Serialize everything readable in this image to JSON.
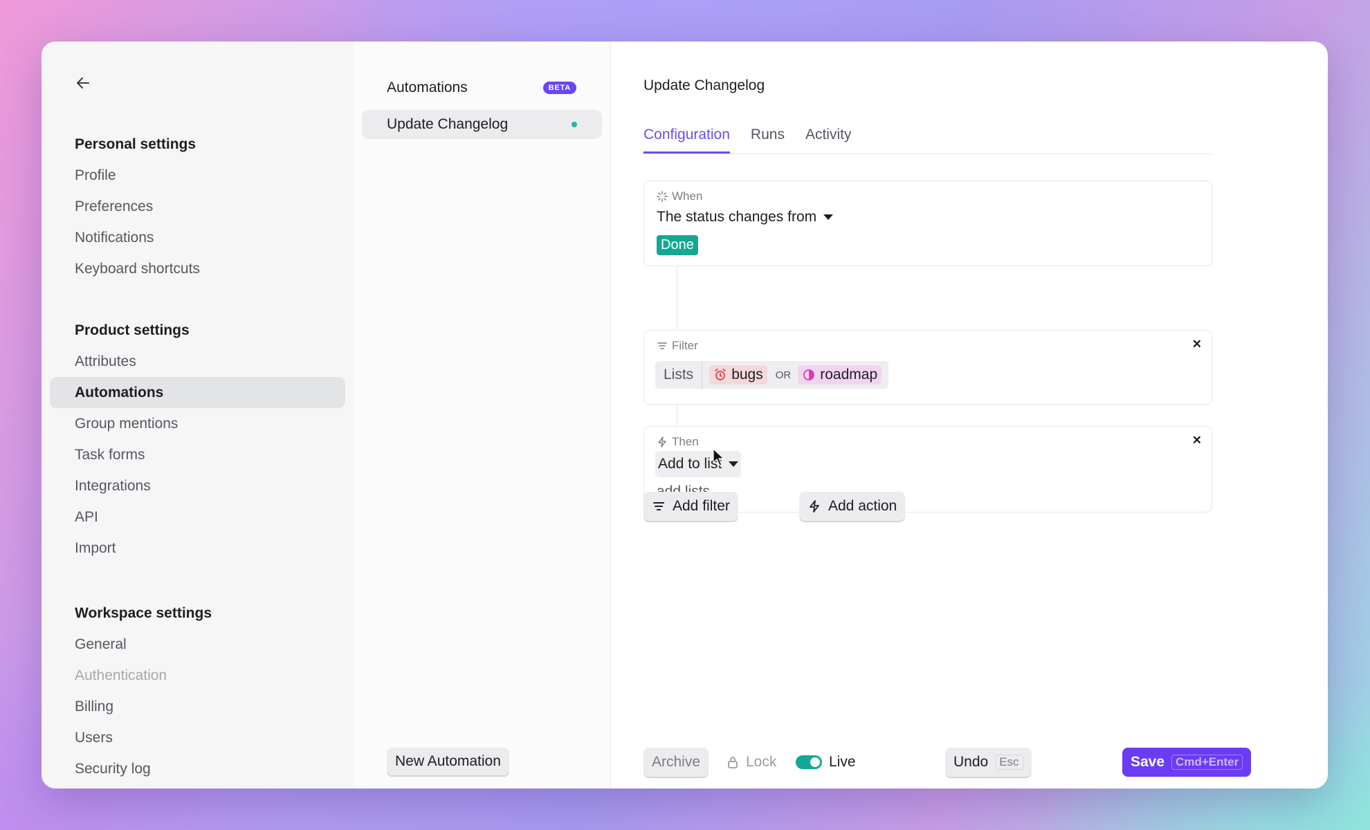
{
  "sidebar": {
    "back_icon": "arrow-left-icon",
    "sections": [
      {
        "title": "Personal settings",
        "items": [
          "Profile",
          "Preferences",
          "Notifications",
          "Keyboard shortcuts"
        ]
      },
      {
        "title": "Product settings",
        "items": [
          "Attributes",
          "Automations",
          "Group mentions",
          "Task forms",
          "Integrations",
          "API",
          "Import"
        ]
      },
      {
        "title": "Workspace settings",
        "items": [
          "General",
          "Authentication",
          "Billing",
          "Users",
          "Security log"
        ]
      }
    ],
    "active_item": "Automations",
    "disabled_item": "Authentication"
  },
  "automations_list": {
    "title": "Automations",
    "badge": "BETA",
    "items": [
      {
        "label": "Update Changelog",
        "status": "active"
      }
    ],
    "new_button": "New Automation"
  },
  "main": {
    "title": "Update Changelog",
    "tabs": [
      "Configuration",
      "Runs",
      "Activity"
    ],
    "active_tab": "Configuration",
    "when": {
      "label": "When",
      "trigger": "The status changes from",
      "value": "Done",
      "value_color": "#14a894"
    },
    "filter": {
      "label": "Filter",
      "field": "Lists",
      "chips": [
        "bugs",
        "roadmap"
      ],
      "operator": "OR"
    },
    "then": {
      "label": "Then",
      "action": "Add to list",
      "placeholder": "add lists..."
    },
    "buttons": {
      "add_filter": "Add filter",
      "add_action": "Add action"
    },
    "footer": {
      "archive": "Archive",
      "lock": "Lock",
      "live": "Live",
      "undo": "Undo",
      "undo_key": "Esc",
      "save": "Save",
      "save_key": "Cmd+Enter"
    }
  },
  "colors": {
    "accent": "#6a3cf5",
    "success": "#14a894"
  }
}
